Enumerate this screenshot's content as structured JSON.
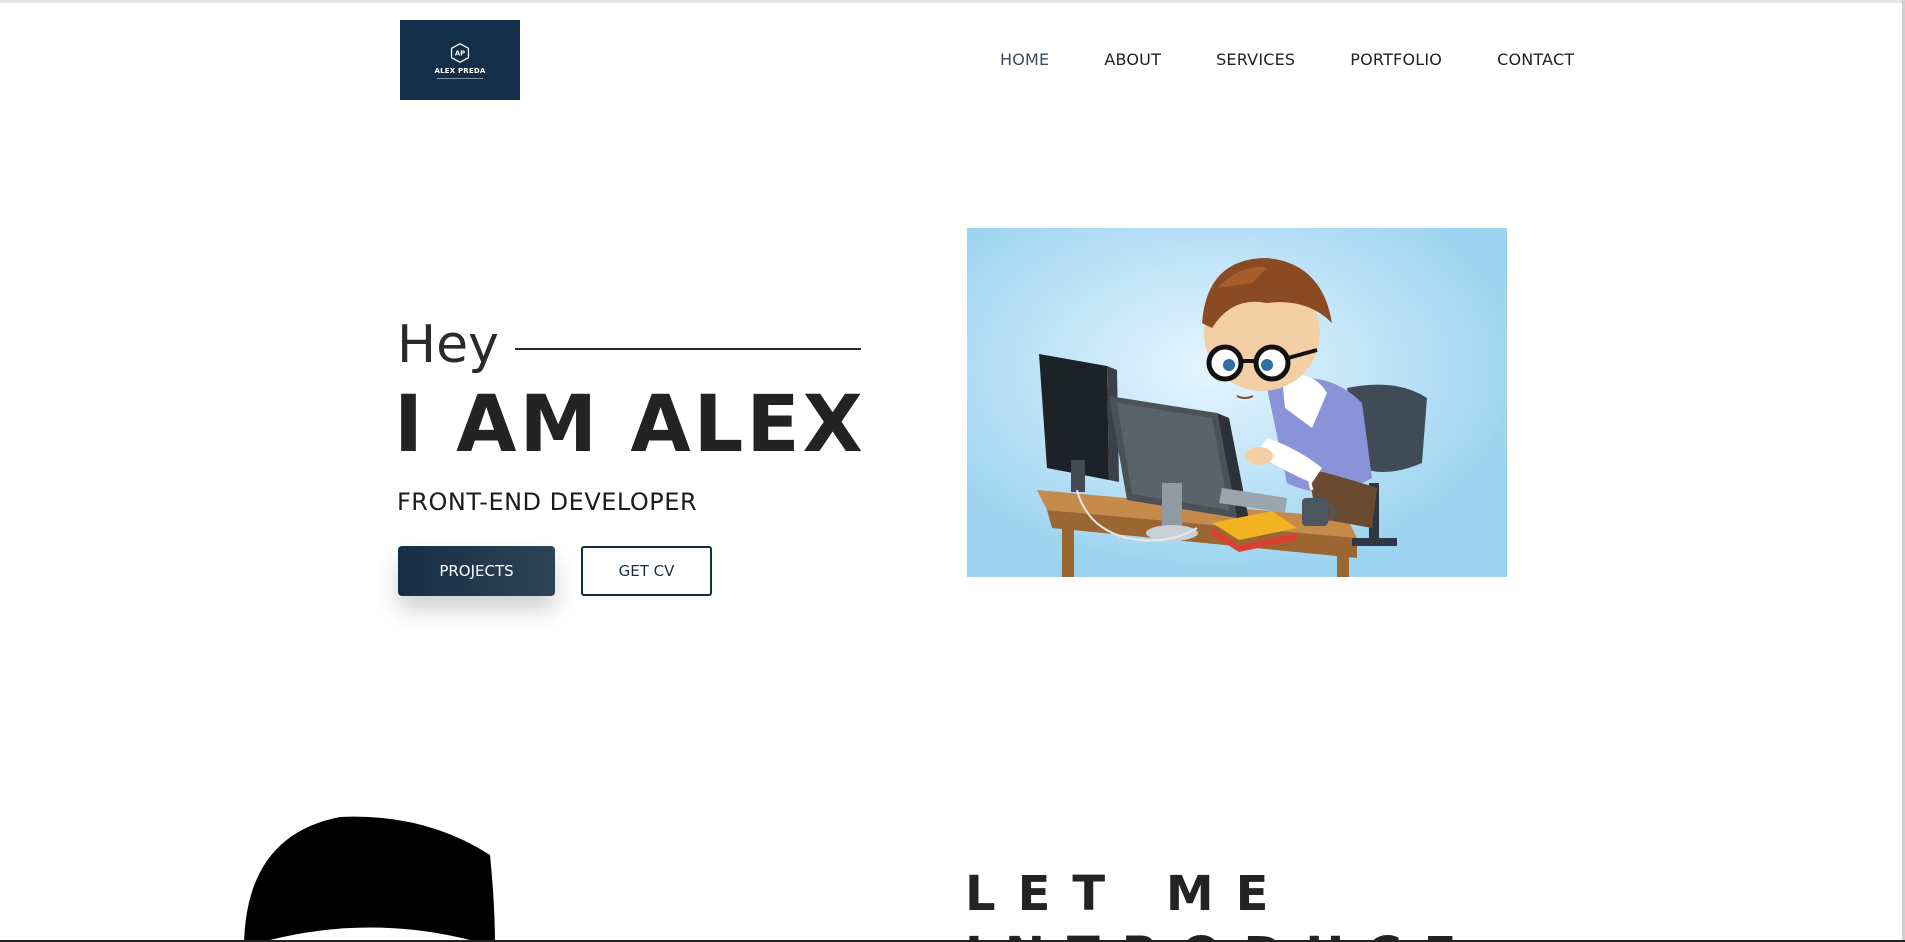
{
  "header": {
    "logo": {
      "badge": "AP",
      "name": "ALEX PREDA",
      "bg_color": "#132e48"
    },
    "nav": [
      {
        "label": "HOME",
        "active": true
      },
      {
        "label": "ABOUT",
        "active": false
      },
      {
        "label": "SERVICES",
        "active": false
      },
      {
        "label": "PORTFOLIO",
        "active": false
      },
      {
        "label": "CONTACT",
        "active": false
      }
    ]
  },
  "hero": {
    "greeting": "Hey",
    "headline": "I AM ALEX",
    "role": "FRONT-END DEVELOPER",
    "primary_button": "PROJECTS",
    "secondary_button": "GET CV",
    "illustration": "developer-at-computer-illustration"
  },
  "intro": {
    "title_line1": "LET ME",
    "title_line2": "INTRODUCE"
  },
  "colors": {
    "accent": "#132e48",
    "illustration_bg": "#9cd3f0",
    "text": "#232323"
  }
}
